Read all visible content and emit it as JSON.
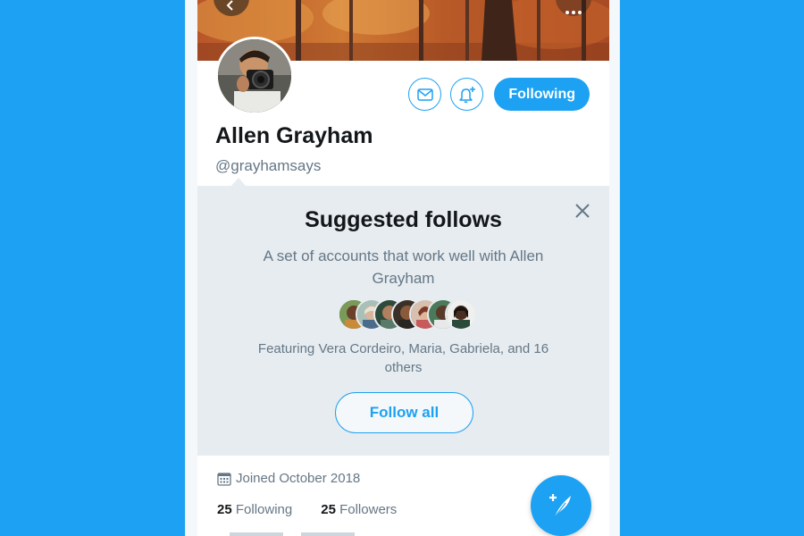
{
  "profile": {
    "name": "Allen Grayham",
    "handle": "@grayhamsays",
    "following_button": "Following"
  },
  "suggested": {
    "title": "Suggested follows",
    "subtitle": "A set of accounts that work well with Allen Grayham",
    "featuring": "Featuring Vera Cordeiro, Maria, Gabriela, and 16 others",
    "follow_all": "Follow all"
  },
  "meta": {
    "joined": "Joined October 2018",
    "following_count": "25",
    "following_label": "Following",
    "followers_count": "25",
    "followers_label": "Followers"
  },
  "icons": {
    "back": "back-arrow-icon",
    "more": "more-options-icon",
    "message": "envelope-icon",
    "notifications": "bell-plus-icon",
    "close": "close-icon",
    "calendar": "calendar-icon",
    "compose": "compose-tweet-icon"
  },
  "colors": {
    "background": "#1da1f2",
    "accent": "#1da1f2",
    "panel": "#e6ecf0",
    "text_primary": "#14171a",
    "text_secondary": "#657786"
  }
}
